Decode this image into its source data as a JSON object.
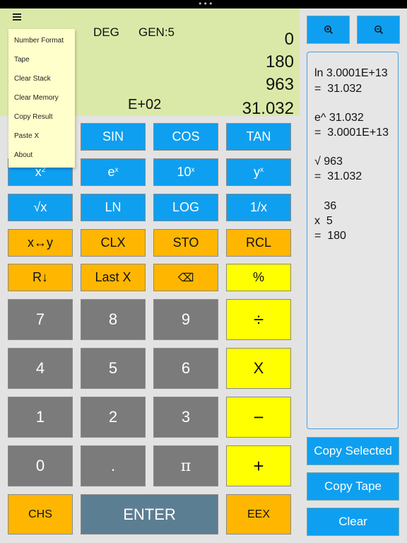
{
  "display": {
    "angle_mode": "DEG",
    "format_mode": "GEN:5",
    "stack": [
      "0",
      "180",
      "963",
      "31.032"
    ],
    "exponent": "E+02",
    "partial_digit": "2"
  },
  "menu": {
    "items": [
      "Number Format",
      "Tape",
      "Clear Stack",
      "Clear Memory",
      "Copy Result",
      "Paste X",
      "About"
    ]
  },
  "keypad": {
    "sin": "SIN",
    "cos": "COS",
    "tan": "TAN",
    "ex_base": "e",
    "ex_sup": "x",
    "tenx_base": "10",
    "tenx_sup": "x",
    "yx_base": "y",
    "yx_sup": "x",
    "x2_base": "x",
    "x2_sup": "2",
    "sqrt": "√x",
    "ln": "LN",
    "log": "LOG",
    "inv": "1/x",
    "swap": "x↔y",
    "clx": "CLX",
    "sto": "STO",
    "rcl": "RCL",
    "roll": "R↓",
    "lastx": "Last X",
    "backspace": "⌫",
    "percent": "%",
    "d7": "7",
    "d8": "8",
    "d9": "9",
    "divide": "÷",
    "d4": "4",
    "d5": "5",
    "d6": "6",
    "multiply": "X",
    "d1": "1",
    "d2": "2",
    "d3": "3",
    "minus": "−",
    "d0": "0",
    "dot": ".",
    "pi": "π",
    "plus": "+",
    "chs": "CHS",
    "enter": "ENTER",
    "eex": "EEX"
  },
  "tape": {
    "lines": [
      "ln 3.0001E+13",
      "=  31.032",
      "e^ 31.032",
      "=  3.0001E+13",
      "√ 963",
      "=  31.032",
      "   36",
      "x  5",
      "=  180"
    ]
  },
  "side": {
    "copy_selected": "Copy Selected",
    "copy_tape": "Copy Tape",
    "clear": "Clear"
  },
  "icons": {
    "menu": "hamburger-icon",
    "zoom_in": "zoom-in-icon",
    "zoom_out": "zoom-out-icon"
  },
  "colors": {
    "display_bg": "#dbe9a8",
    "function_key": "#0f9ff0",
    "stack_key": "#ffb600",
    "digit_key": "#7b7b7b",
    "operator_key": "#ffff00",
    "enter_key": "#5c7e93",
    "menu_bg": "#ffffcc"
  }
}
